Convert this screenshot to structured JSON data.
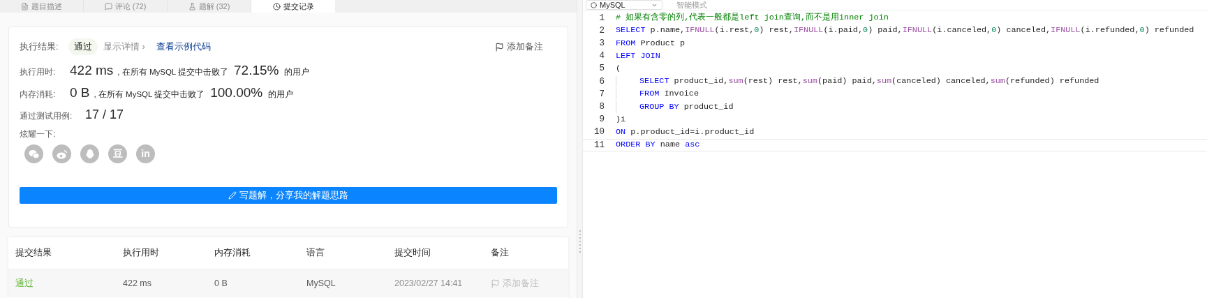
{
  "tabs": [
    {
      "label": "题目描述",
      "selected": false
    },
    {
      "label": "评论 (72)",
      "selected": false
    },
    {
      "label": "题解 (32)",
      "selected": false
    },
    {
      "label": "提交记录",
      "selected": true
    }
  ],
  "result": {
    "label": "执行结果:",
    "status": "通过",
    "details_link": "显示详情 ›",
    "sample_link": "查看示例代码",
    "note_button": "添加备注"
  },
  "stats": [
    {
      "label": "执行用时:",
      "value": "422 ms",
      "detail": ", 在所有 MySQL 提交中击败了",
      "percent": "72.15%",
      "suffix": "的用户"
    },
    {
      "label": "内存消耗:",
      "value": "0 B",
      "detail": ", 在所有 MySQL 提交中击败了",
      "percent": "100.00%",
      "suffix": "的用户"
    }
  ],
  "tests": {
    "label": "通过测试用例:",
    "value": "17 / 17"
  },
  "share": {
    "label": "炫耀一下:",
    "icons": [
      {
        "kind": "wechat"
      },
      {
        "kind": "weibo"
      },
      {
        "kind": "qq"
      },
      {
        "kind": "text",
        "text": "豆"
      },
      {
        "kind": "text",
        "text": "in"
      }
    ]
  },
  "write_button": "写题解，分享我的解题思路",
  "table": {
    "columns": [
      "提交结果",
      "执行用时",
      "内存消耗",
      "语言",
      "提交时间",
      "备注"
    ],
    "rows": [
      {
        "status": "通过",
        "passed": true,
        "runtime": "422 ms",
        "memory": "0 B",
        "language": "MySQL",
        "time": "2023/02/27 14:41",
        "note": "添加备注"
      }
    ]
  },
  "editor": {
    "language": "MySQL",
    "mode": "智能模式",
    "lines": [
      {
        "number": "1",
        "tokens": [
          {
            "kind": "cm",
            "text": "# 如果有含零的列,代表一般都是left join查询,而不是用inner join"
          }
        ]
      },
      {
        "number": "2",
        "tokens": [
          {
            "kind": "kw",
            "text": "SELECT"
          },
          {
            "kind": "plain",
            "text": " p.name,"
          },
          {
            "kind": "fn",
            "text": "IFNULL"
          },
          {
            "kind": "plain",
            "text": "(i.rest,"
          },
          {
            "kind": "num",
            "text": "0"
          },
          {
            "kind": "plain",
            "text": ") rest,"
          },
          {
            "kind": "fn",
            "text": "IFNULL"
          },
          {
            "kind": "plain",
            "text": "(i.paid,"
          },
          {
            "kind": "num",
            "text": "0"
          },
          {
            "kind": "plain",
            "text": ") paid,"
          },
          {
            "kind": "fn",
            "text": "IFNULL"
          },
          {
            "kind": "plain",
            "text": "(i.canceled,"
          },
          {
            "kind": "num",
            "text": "0"
          },
          {
            "kind": "plain",
            "text": ") canceled,"
          },
          {
            "kind": "fn",
            "text": "IFNULL"
          },
          {
            "kind": "plain",
            "text": "(i.refunded,"
          },
          {
            "kind": "num",
            "text": "0"
          },
          {
            "kind": "plain",
            "text": ") refunded"
          }
        ]
      },
      {
        "number": "3",
        "tokens": [
          {
            "kind": "kw",
            "text": "FROM"
          },
          {
            "kind": "plain",
            "text": " Product p"
          }
        ]
      },
      {
        "number": "4",
        "tokens": [
          {
            "kind": "kw",
            "text": "LEFT JOIN"
          }
        ]
      },
      {
        "number": "5",
        "tokens": [
          {
            "kind": "plain",
            "text": "("
          }
        ]
      },
      {
        "number": "6",
        "indented": true,
        "tokens": [
          {
            "kind": "kw",
            "text": "SELECT"
          },
          {
            "kind": "plain",
            "text": " product_id,"
          },
          {
            "kind": "fn",
            "text": "sum"
          },
          {
            "kind": "plain",
            "text": "(rest) rest,"
          },
          {
            "kind": "fn",
            "text": "sum"
          },
          {
            "kind": "plain",
            "text": "(paid) paid,"
          },
          {
            "kind": "fn",
            "text": "sum"
          },
          {
            "kind": "plain",
            "text": "(canceled) canceled,"
          },
          {
            "kind": "fn",
            "text": "sum"
          },
          {
            "kind": "plain",
            "text": "(refunded) refunded"
          }
        ]
      },
      {
        "number": "7",
        "indented": true,
        "tokens": [
          {
            "kind": "kw",
            "text": "FROM"
          },
          {
            "kind": "plain",
            "text": " Invoice"
          }
        ]
      },
      {
        "number": "8",
        "indented": true,
        "tokens": [
          {
            "kind": "kw",
            "text": "GROUP BY"
          },
          {
            "kind": "plain",
            "text": " product_id"
          }
        ]
      },
      {
        "number": "9",
        "tokens": [
          {
            "kind": "plain",
            "text": ")i"
          }
        ]
      },
      {
        "number": "10",
        "tokens": [
          {
            "kind": "kw",
            "text": "ON"
          },
          {
            "kind": "plain",
            "text": " p.product_id=i.product_id"
          }
        ]
      },
      {
        "number": "11",
        "active": true,
        "tokens": [
          {
            "kind": "kw",
            "text": "ORDER BY"
          },
          {
            "kind": "plain",
            "text": " name "
          },
          {
            "kind": "kw",
            "text": "asc"
          }
        ]
      }
    ]
  }
}
